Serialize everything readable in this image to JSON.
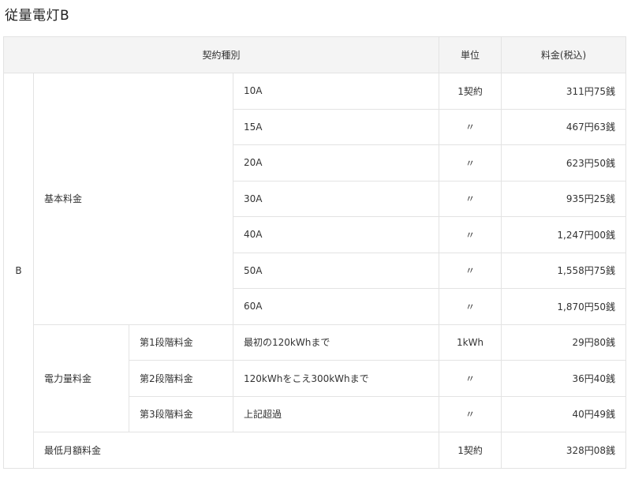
{
  "title": "従量電灯B",
  "table": {
    "headers": {
      "contract_type": "契約種別",
      "unit": "単位",
      "price": "料金(税込)"
    },
    "contract_class": "B",
    "basic": {
      "label": "基本料金",
      "rows": [
        {
          "amp": "10A",
          "unit": "1契約",
          "price": "311円75銭"
        },
        {
          "amp": "15A",
          "unit": "〃",
          "price": "467円63銭"
        },
        {
          "amp": "20A",
          "unit": "〃",
          "price": "623円50銭"
        },
        {
          "amp": "30A",
          "unit": "〃",
          "price": "935円25銭"
        },
        {
          "amp": "40A",
          "unit": "〃",
          "price": "1,247円00銭"
        },
        {
          "amp": "50A",
          "unit": "〃",
          "price": "1,558円75銭"
        },
        {
          "amp": "60A",
          "unit": "〃",
          "price": "1,870円50銭"
        }
      ]
    },
    "energy": {
      "label": "電力量料金",
      "rows": [
        {
          "tier": "第1段階料金",
          "range": "最初の120kWhまで",
          "unit": "1kWh",
          "price": "29円80銭"
        },
        {
          "tier": "第2段階料金",
          "range": "120kWhをこえ300kWhまで",
          "unit": "〃",
          "price": "36円40銭"
        },
        {
          "tier": "第3段階料金",
          "range": "上記超過",
          "unit": "〃",
          "price": "40円49銭"
        }
      ]
    },
    "minimum": {
      "label": "最低月額料金",
      "unit": "1契約",
      "price": "328円08銭"
    }
  }
}
